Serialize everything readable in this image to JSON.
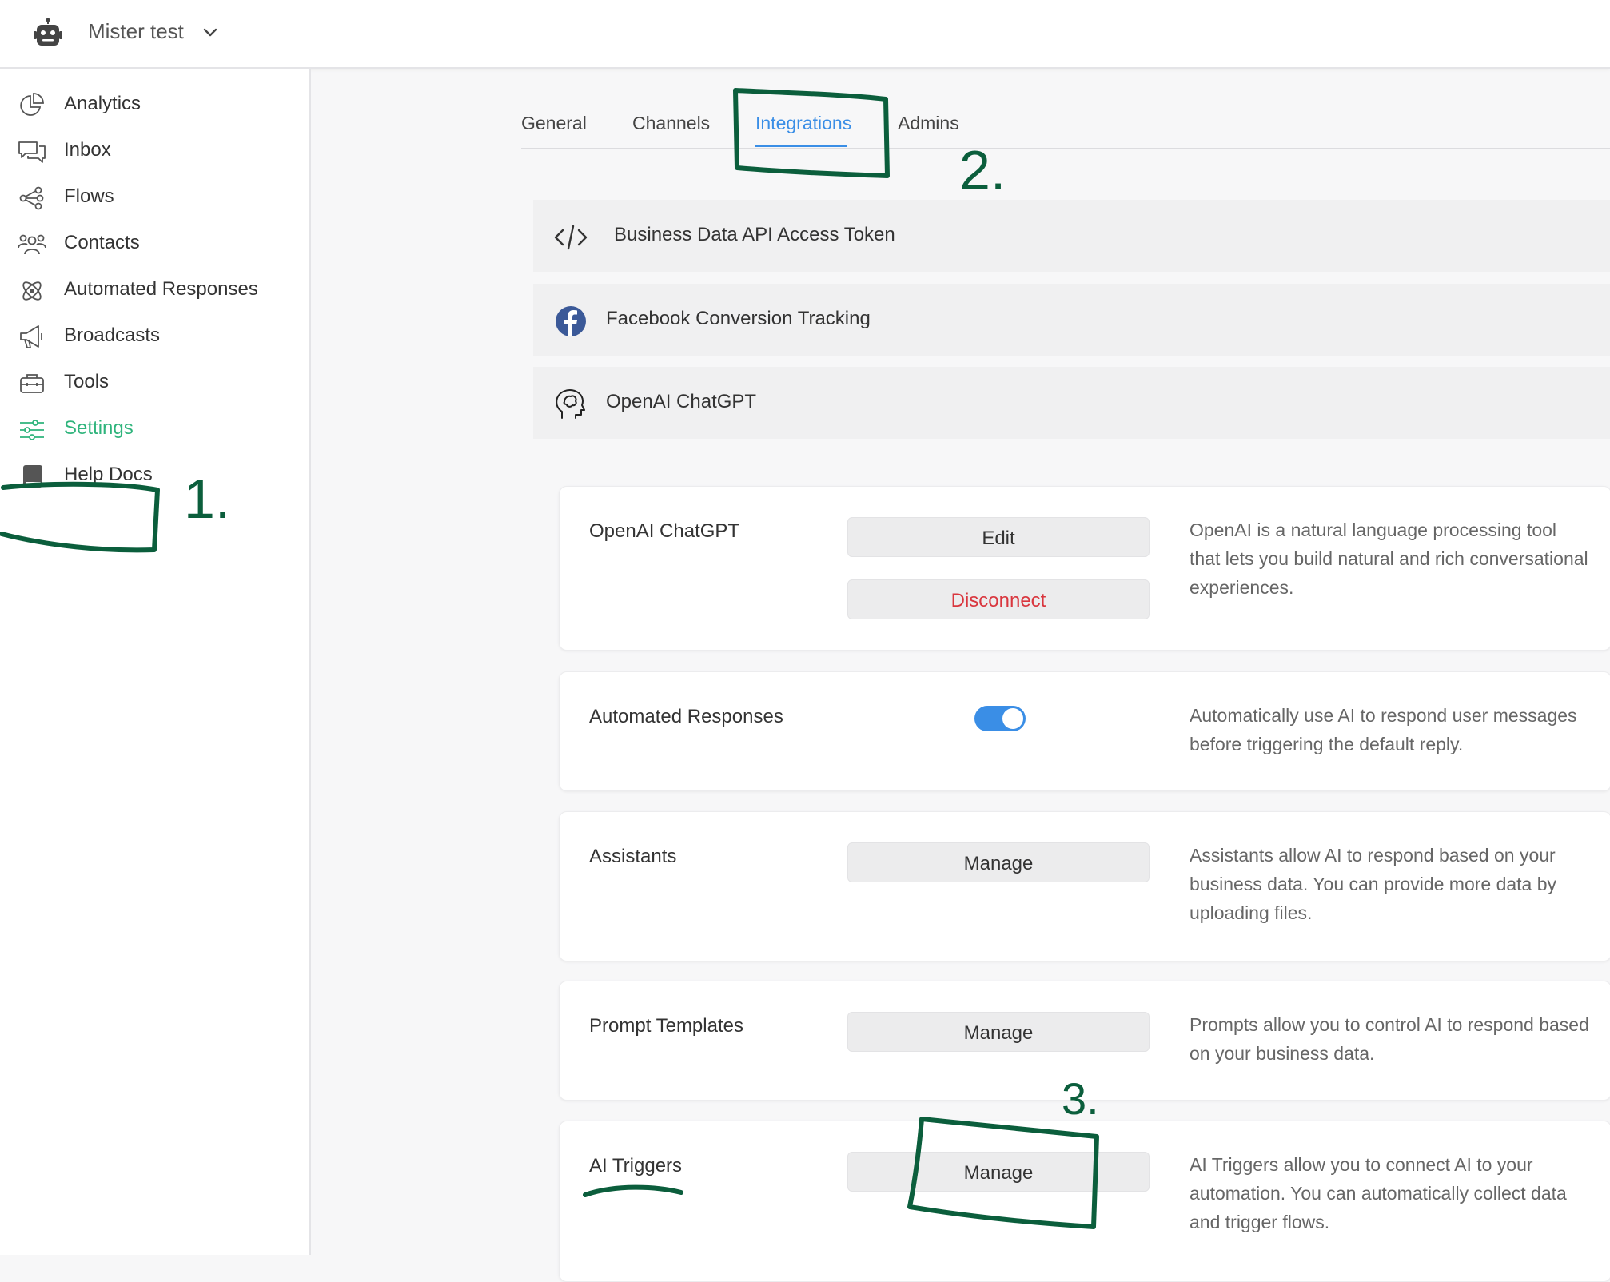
{
  "header": {
    "workspace_name": "Mister test"
  },
  "sidebar": {
    "items": [
      {
        "label": "Analytics",
        "icon": "analytics-icon"
      },
      {
        "label": "Inbox",
        "icon": "inbox-icon"
      },
      {
        "label": "Flows",
        "icon": "flows-icon"
      },
      {
        "label": "Contacts",
        "icon": "contacts-icon"
      },
      {
        "label": "Automated Responses",
        "icon": "atom-icon"
      },
      {
        "label": "Broadcasts",
        "icon": "megaphone-icon"
      },
      {
        "label": "Tools",
        "icon": "toolbox-icon"
      },
      {
        "label": "Settings",
        "icon": "sliders-icon",
        "active": true
      },
      {
        "label": "Help Docs",
        "icon": "book-icon"
      }
    ]
  },
  "tabs": [
    {
      "label": "General"
    },
    {
      "label": "Channels"
    },
    {
      "label": "Integrations",
      "active": true
    },
    {
      "label": "Admins"
    }
  ],
  "integrations": [
    {
      "label": "Business Data API Access Token",
      "icon": "code-icon"
    },
    {
      "label": "Facebook Conversion Tracking",
      "icon": "facebook-icon"
    },
    {
      "label": "OpenAI ChatGPT",
      "icon": "brain-head-icon"
    }
  ],
  "cards": {
    "openai": {
      "title": "OpenAI ChatGPT",
      "edit_label": "Edit",
      "disconnect_label": "Disconnect",
      "description": "OpenAI is a natural language processing tool that lets you build natural and rich conversational experiences."
    },
    "automated": {
      "title": "Automated Responses",
      "toggle_on": true,
      "description": "Automatically use AI to respond user messages before triggering the default reply."
    },
    "assistants": {
      "title": "Assistants",
      "button_label": "Manage",
      "description": "Assistants allow AI to respond based on your business data. You can provide more data by uploading files."
    },
    "prompts": {
      "title": "Prompt Templates",
      "button_label": "Manage",
      "description": "Prompts allow you to control AI to respond based on your business data."
    },
    "triggers": {
      "title": "AI Triggers",
      "button_label": "Manage",
      "description": "AI Triggers allow you to connect AI to your automation. You can automatically collect data and trigger flows."
    }
  },
  "annotations": {
    "step1": "1.",
    "step2": "2.",
    "step3": "3."
  },
  "colors": {
    "accent": "#3a8ee6",
    "active_nav": "#2fb47c",
    "danger": "#d9363e",
    "annotation": "#0b5e3c",
    "facebook": "#3b5998"
  }
}
